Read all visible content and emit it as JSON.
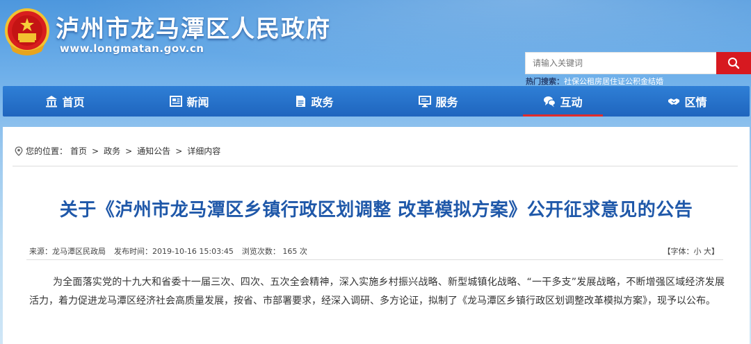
{
  "header": {
    "site_title": "泸州市龙马潭区人民政府",
    "site_url": "www.longmatan.gov.cn",
    "search": {
      "placeholder": "请输入关键词",
      "button_icon": "search-icon"
    },
    "hot": {
      "label": "热门搜索：",
      "items": [
        "社保",
        "公租房",
        "居住证",
        "公积金",
        "结婚"
      ]
    }
  },
  "nav": {
    "items": [
      {
        "label": "首页",
        "icon": "building-icon"
      },
      {
        "label": "新闻",
        "icon": "news-icon"
      },
      {
        "label": "政务",
        "icon": "document-icon"
      },
      {
        "label": "服务",
        "icon": "monitor-icon"
      },
      {
        "label": "互动",
        "icon": "chat-icon"
      },
      {
        "label": "区情",
        "icon": "handshake-icon"
      }
    ],
    "active": "互动"
  },
  "breadcrumb": {
    "prefix": "您的位置：",
    "items": [
      "首页",
      "政务",
      "通知公告",
      "详细内容"
    ],
    "sep": ">"
  },
  "article": {
    "title": "关于《泸州市龙马潭区乡镇行政区划调整 改革模拟方案》公开征求意见的公告",
    "meta": {
      "source": "来源：龙马潭区民政局",
      "time": "发布时间：2019-10-16 15:03:45",
      "views": "浏览次数： 165 次"
    },
    "font_size": {
      "prefix": "【字体：",
      "small": "小",
      "big": "大",
      "suffix": "】"
    },
    "body": "为全面落实党的十九大和省委十一届三次、四次、五次全会精神，深入实施乡村振兴战略、新型城镇化战略、“一干多支”发展战略，不断增强区域经济发展活力，着力促进龙马潭区经济社会高质量发展，按省、市部署要求，经深入调研、多方论证，拟制了《龙马潭区乡镇行政区划调整改革模拟方案》，现予以公布。"
  },
  "colors": {
    "nav_bg": "#2370c8",
    "active_underline": "#e02b2b",
    "search_button": "#d71920",
    "title_blue": "#1f58a9"
  }
}
